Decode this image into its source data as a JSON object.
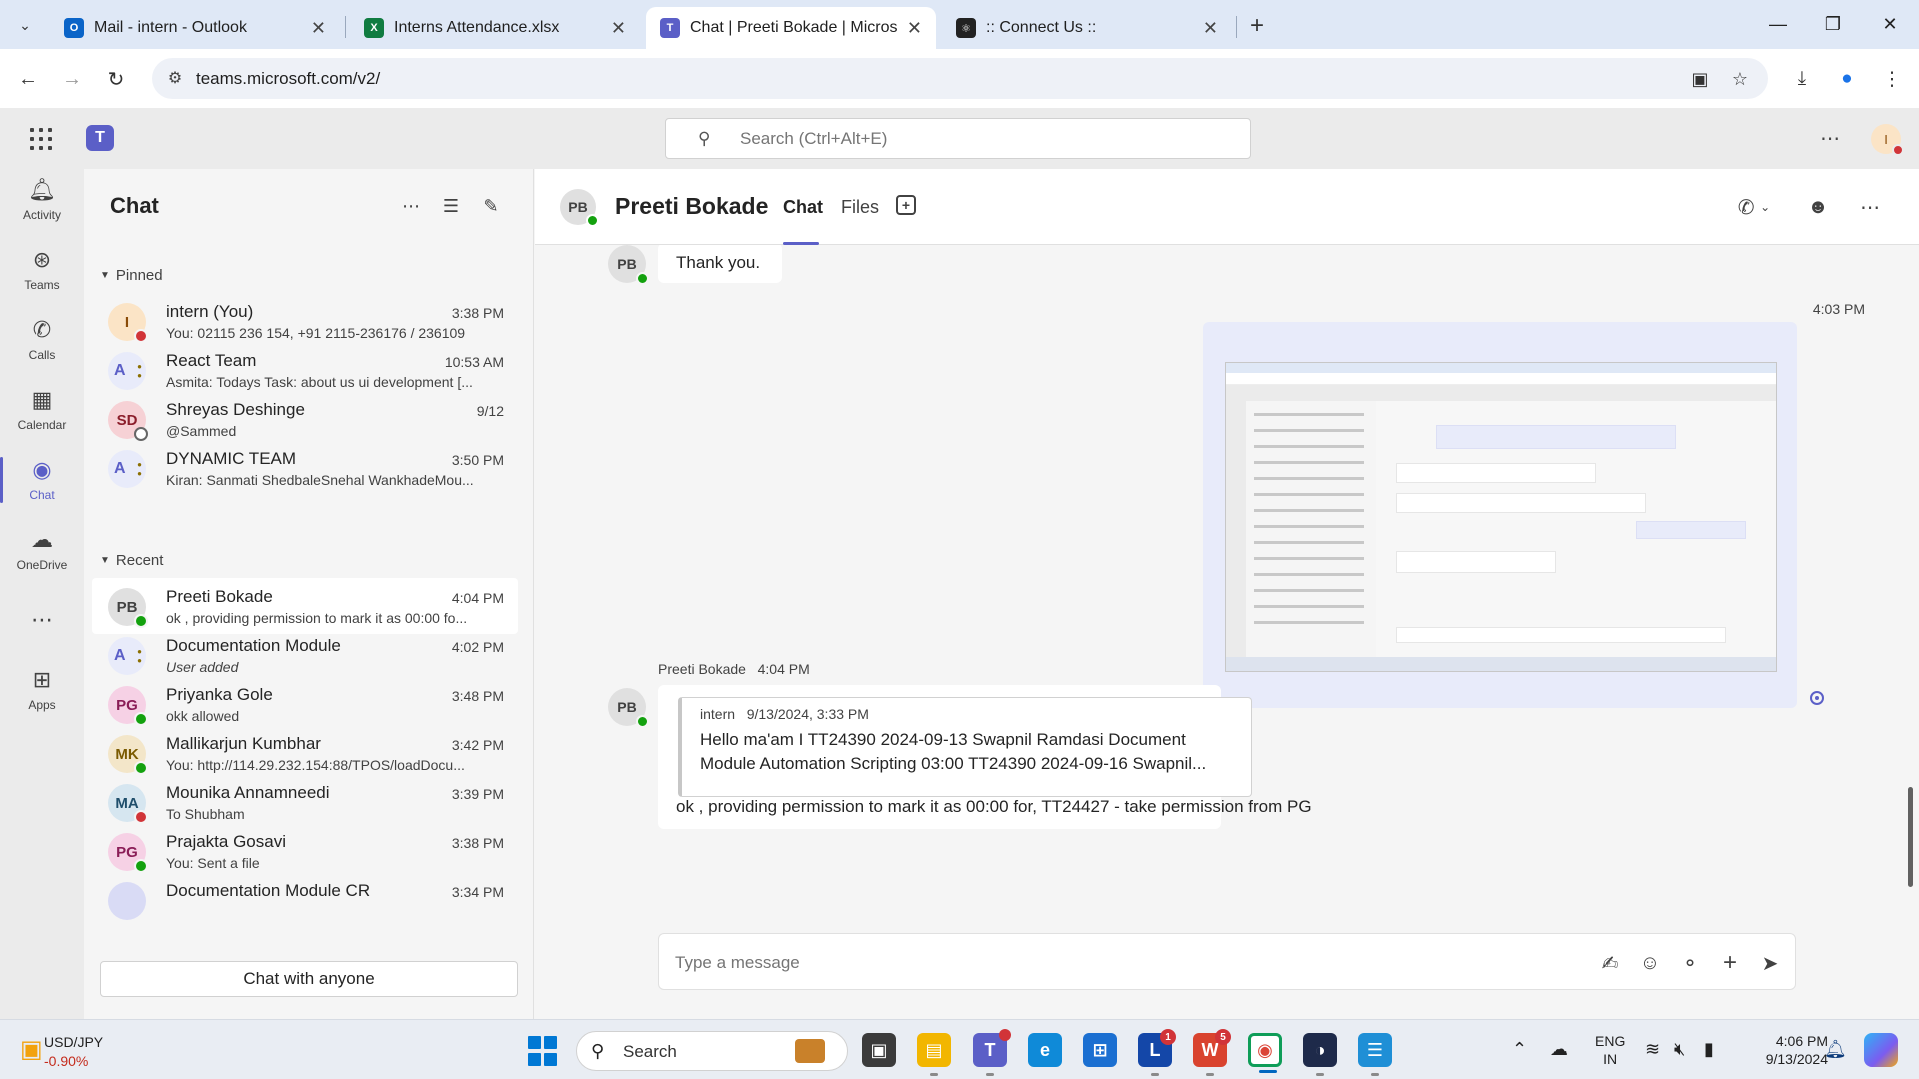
{
  "browser": {
    "tabs": [
      {
        "title": "Mail - intern - Outlook",
        "favicon": "outlook-icon",
        "color": "#0a64c8"
      },
      {
        "title": "Interns Attendance.xlsx",
        "favicon": "excel-icon",
        "color": "#107c41"
      },
      {
        "title": "Chat | Preeti Bokade | Microsoft",
        "favicon": "teams-icon",
        "color": "#5b5fc7"
      },
      {
        "title": ":: Connect Us ::",
        "favicon": "react-icon",
        "color": "#222222"
      }
    ],
    "url": "teams.microsoft.com/v2/"
  },
  "teams": {
    "search_placeholder": "Search (Ctrl+Alt+E)",
    "me_initial": "I",
    "rail": [
      {
        "label": "Activity",
        "icon": "bell-icon"
      },
      {
        "label": "Teams",
        "icon": "teams-people-icon"
      },
      {
        "label": "Calls",
        "icon": "phone-icon"
      },
      {
        "label": "Calendar",
        "icon": "calendar-icon"
      },
      {
        "label": "Chat",
        "icon": "chat-icon"
      },
      {
        "label": "OneDrive",
        "icon": "cloud-icon"
      },
      {
        "label": "Apps",
        "icon": "apps-plus-icon"
      }
    ]
  },
  "chatlist": {
    "title": "Chat",
    "pinned_label": "Pinned",
    "recent_label": "Recent",
    "chat_with_anyone": "Chat with anyone",
    "pinned": [
      {
        "initials": "I",
        "name": "intern (You)",
        "time": "3:38 PM",
        "preview": "You: 02115 236 154, +91 2115-236176 / 236109",
        "avatar_bg": "#fbe4c6",
        "avatar_fg": "#8a4b08"
      },
      {
        "initials": "A",
        "name": "React Team",
        "time": "10:53 AM",
        "preview": "Asmita: Todays Task: about us ui development [...",
        "group": true
      },
      {
        "initials": "SD",
        "name": "Shreyas Deshinge",
        "time": "9/12",
        "preview": "@Sammed",
        "avatar_bg": "#f6d1d5",
        "avatar_fg": "#8b1e2b"
      },
      {
        "initials": "A",
        "name": "DYNAMIC TEAM",
        "time": "3:50 PM",
        "preview": "Kiran: Sanmati ShedbaleSnehal WankhadeMou...",
        "group": true
      }
    ],
    "recent": [
      {
        "initials": "PB",
        "name": "Preeti Bokade",
        "time": "4:04 PM",
        "preview": "ok , providing permission to mark it as 00:00 fo...",
        "avatar_bg": "#e0e0e0",
        "avatar_fg": "#424242"
      },
      {
        "initials": "A",
        "name": "Documentation Module",
        "time": "4:02 PM",
        "preview": "User added",
        "group": true
      },
      {
        "initials": "PG",
        "name": "Priyanka Gole",
        "time": "3:48 PM",
        "preview": "okk allowed",
        "avatar_bg": "#f6d1e5",
        "avatar_fg": "#8a1d57"
      },
      {
        "initials": "MK",
        "name": "Mallikarjun Kumbhar",
        "time": "3:42 PM",
        "preview": "You: http://114.29.232.154:88/TPOS/loadDocu...",
        "avatar_bg": "#f3e6c9",
        "avatar_fg": "#7a5a00"
      },
      {
        "initials": "MA",
        "name": "Mounika Annamneedi",
        "time": "3:39 PM",
        "preview": "To Shubham",
        "avatar_bg": "#d6e6f0",
        "avatar_fg": "#1f4e6b"
      },
      {
        "initials": "PG",
        "name": "Prajakta Gosavi",
        "time": "3:38 PM",
        "preview": "You: Sent a file",
        "avatar_bg": "#f6d1e5",
        "avatar_fg": "#8a1d57"
      },
      {
        "initials": "",
        "name": "Documentation Module CR",
        "time": "3:34 PM",
        "preview": "",
        "avatar_bg": "#d9dbf5",
        "avatar_fg": "#5b5fc7"
      }
    ]
  },
  "conversation": {
    "contact_initials": "PB",
    "contact_name": "Preeti Bokade",
    "tab_chat": "Chat",
    "tab_files": "Files",
    "prev_message": "Thank you.",
    "my_image_time": "4:03 PM",
    "reply_sender": "Preeti Bokade",
    "reply_time": "4:04 PM",
    "quote_author": "intern",
    "quote_time": "9/13/2024, 3:33 PM",
    "quote_text": "Hello ma'am I TT24390 2024-09-13 Swapnil Ramdasi Document Module Automation Scripting 03:00 TT24390 2024-09-16 Swapnil...",
    "reply_text": "ok , providing permission to mark it as 00:00 for, TT24427 - take permission from PG",
    "composer_placeholder": "Type a message"
  },
  "taskbar": {
    "fx_pair": "USD/JPY",
    "fx_change": "-0.90%",
    "search_label": "Search",
    "lang": "ENG",
    "region": "IN",
    "time": "4:06 PM",
    "date": "9/13/2024",
    "teams_badge": "",
    "l_badge": "1",
    "w_badge": "5"
  },
  "colors": {
    "accent": "#5b5fc7",
    "presence_available": "#13a10e",
    "presence_busy": "#d13438"
  }
}
